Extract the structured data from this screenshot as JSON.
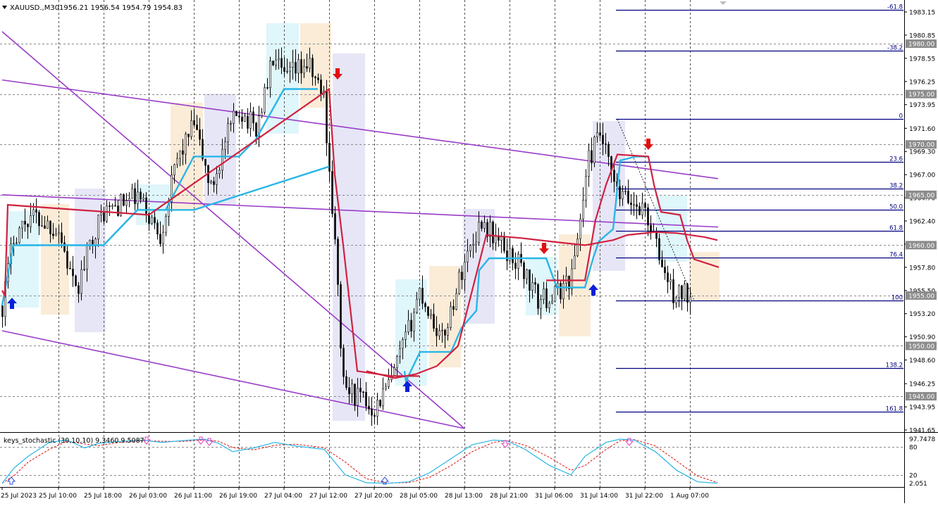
{
  "header": {
    "symbol_info": "XAUUSD.,M30",
    "ohlc": "1956.21 1956.54 1954.79 1954.83"
  },
  "indicator": {
    "label": "keys_stochastic (30,10,10) 9.3460 9.5087",
    "level_labels": [
      "97.7478",
      "80",
      "20",
      "2.051"
    ]
  },
  "price_axis": {
    "ticks": [
      "1983.15",
      "1980.85",
      "1978.55",
      "1976.25",
      "1973.95",
      "1971.60",
      "1969.30",
      "1967.00",
      "1964.70",
      "1962.40",
      "1960.10",
      "1957.80",
      "1955.50",
      "1953.20",
      "1950.90",
      "1948.60",
      "1946.25",
      "1943.95",
      "1941.65"
    ],
    "level_tags": [
      "1980.00",
      "1975.00",
      "1970.00",
      "1965.00",
      "1960.00",
      "1955.00",
      "1950.00",
      "1945.00"
    ]
  },
  "time_axis": {
    "labels": [
      "25 Jul 2023",
      "25 Jul 10:00",
      "25 Jul 18:00",
      "26 Jul 03:00",
      "26 Jul 11:00",
      "26 Jul 19:00",
      "27 Jul 04:00",
      "27 Jul 12:00",
      "27 Jul 20:00",
      "28 Jul 05:00",
      "28 Jul 13:00",
      "28 Jul 21:00",
      "31 Jul 06:00",
      "31 Jul 14:00",
      "31 Jul 22:00",
      "1 Aug 07:00"
    ]
  },
  "fibonacci": {
    "levels": [
      "-61.8",
      "-38.2",
      "0",
      "23.6",
      "38.2",
      "50.0",
      "61.8",
      "76.4",
      "100",
      "138.2",
      "161.8"
    ]
  },
  "colors": {
    "candle": "#000000",
    "fast_line": "#29b6e6",
    "slow_line": "#d0213f",
    "channel": "#9a3cc8",
    "fib": "#000080",
    "zone_blue": "#dff6fb",
    "zone_orange": "#fbecd8",
    "zone_lavender": "#e6e6f7",
    "arrow_up": "#0a1fd9",
    "arrow_down": "#e01010",
    "stoch_main": "#29b6e6",
    "stoch_signal": "#e01010",
    "stoch_marker": "#e040c0"
  },
  "chart_data": {
    "type": "candlestick",
    "symbol": "XAUUSD.",
    "timeframe": "M30",
    "ylim": [
      1941.65,
      1984.3
    ],
    "anchors": [
      [
        "25 Jul 2023",
        1954.0
      ],
      [
        "25 Jul 02:00",
        1961.0
      ],
      [
        "25 Jul 05:00",
        1963.0
      ],
      [
        "25 Jul 10:00",
        1961.5
      ],
      [
        "25 Jul 13:00",
        1955.0
      ],
      [
        "25 Jul 16:00",
        1961.0
      ],
      [
        "25 Jul 18:00",
        1963.3
      ],
      [
        "26 Jul 01:00",
        1964.8
      ],
      [
        "26 Jul 05:00",
        1961.0
      ],
      [
        "26 Jul 08:00",
        1968.5
      ],
      [
        "26 Jul 11:00",
        1972.0
      ],
      [
        "26 Jul 14:00",
        1965.5
      ],
      [
        "26 Jul 17:00",
        1971.0
      ],
      [
        "26 Jul 19:00",
        1973.5
      ],
      [
        "26 Jul 22:00",
        1971.5
      ],
      [
        "27 Jul 02:00",
        1978.5
      ],
      [
        "27 Jul 04:00",
        1976.5
      ],
      [
        "27 Jul 08:00",
        1978.0
      ],
      [
        "27 Jul 11:00",
        1974.8
      ],
      [
        "27 Jul 13:00",
        1960.0
      ],
      [
        "27 Jul 14:30",
        1946.0
      ],
      [
        "27 Jul 18:00",
        1944.5
      ],
      [
        "27 Jul 20:00",
        1943.8
      ],
      [
        "27 Jul 23:00",
        1946.5
      ],
      [
        "28 Jul 03:00",
        1951.5
      ],
      [
        "28 Jul 05:00",
        1955.5
      ],
      [
        "28 Jul 09:00",
        1950.5
      ],
      [
        "28 Jul 13:00",
        1958.5
      ],
      [
        "28 Jul 16:00",
        1962.5
      ],
      [
        "28 Jul 19:00",
        1960.3
      ],
      [
        "28 Jul 21:00",
        1959.0
      ],
      [
        "31 Jul 00:00",
        1958.0
      ],
      [
        "31 Jul 03:00",
        1954.5
      ],
      [
        "31 Jul 06:00",
        1955.0
      ],
      [
        "31 Jul 09:00",
        1957.0
      ],
      [
        "31 Jul 12:00",
        1968.5
      ],
      [
        "31 Jul 14:00",
        1971.0
      ],
      [
        "31 Jul 17:00",
        1965.0
      ],
      [
        "31 Jul 22:00",
        1963.5
      ],
      [
        "1 Aug 02:00",
        1958.0
      ],
      [
        "1 Aug 04:00",
        1955.0
      ],
      [
        "1 Aug 07:00",
        1955.3
      ]
    ],
    "fast_line": [
      [
        "25 Jul 2023",
        1954.0
      ],
      [
        "25 Jul 02:00",
        1960.0
      ],
      [
        "25 Jul 10:00",
        1960.0
      ],
      [
        "25 Jul 18:00",
        1960.0
      ],
      [
        "26 Jul 01:00",
        1963.5
      ],
      [
        "26 Jul 06:00",
        1963.5
      ],
      [
        "26 Jul 11:00",
        1968.8
      ],
      [
        "26 Jul 19:00",
        1968.8
      ],
      [
        "26 Jul 22:00",
        1970.5
      ],
      [
        "27 Jul 04:00",
        1975.5
      ],
      [
        "27 Jul 10:00",
        1975.5
      ]
    ],
    "fast_line_2": [
      [
        "25 Jul 2023",
        1954.0
      ],
      [
        "25 Jul 02:00",
        1960.0
      ],
      [
        "25 Jul 18:00",
        1960.0
      ],
      [
        "26 Jul 01:00",
        1963.5
      ],
      [
        "26 Jul 11:00",
        1963.5
      ],
      [
        "27 Jul 12:00",
        1967.8
      ]
    ],
    "slow_line": [
      [
        "25 Jul 2023",
        1955.5
      ],
      [
        "25 Jul 00:30",
        1955.0
      ],
      [
        "25 Jul 01:00",
        1964.0
      ],
      [
        "26 Jul 03:00",
        1963.0
      ],
      [
        "27 Jul 12:00",
        1975.5
      ],
      [
        "27 Jul 13:00",
        1967.0
      ],
      [
        "27 Jul 14:30",
        1960.0
      ],
      [
        "27 Jul 17:00",
        1947.5
      ],
      [
        "28 Jul 00:00",
        1947.0
      ],
      [
        "28 Jul 05:00",
        1947.0
      ]
    ],
    "channel_lines": [
      [
        [
          "25 Jul 2023",
          1981.2
        ],
        [
          "28 Jul 13:00",
          1941.8
        ]
      ],
      [
        [
          "25 Jul 2023",
          1976.4
        ],
        [
          "1 Aug 12:00",
          1966.6
        ]
      ],
      [
        [
          "25 Jul 2023",
          1965.0
        ],
        [
          "1 Aug 12:00",
          1961.8
        ]
      ],
      [
        [
          "25 Jul 2023",
          1951.5
        ],
        [
          "28 Jul 13:00",
          1941.8
        ]
      ]
    ],
    "fibonacci_price": {
      "-61.8": 1983.35,
      "-38.2": 1979.3,
      "0": 1972.5,
      "23.6": 1968.3,
      "38.2": 1965.6,
      "50.0": 1963.5,
      "61.8": 1961.4,
      "76.4": 1958.8,
      "100": 1954.5,
      "138.2": 1947.8,
      "161.8": 1943.5
    },
    "stochastic_ylim": [
      0,
      100
    ],
    "stochastic_levels": [
      80,
      20
    ]
  }
}
